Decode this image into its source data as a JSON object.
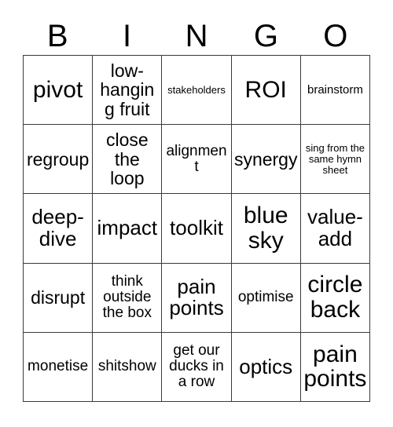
{
  "card": {
    "header": {
      "letters": [
        "B",
        "I",
        "N",
        "G",
        "O"
      ]
    },
    "grid": {
      "rows": [
        [
          {
            "text": "pivot",
            "size": "fs-xxl"
          },
          {
            "text": "low-hanging fruit",
            "size": "fs-lg"
          },
          {
            "text": "stakeholders",
            "size": "fs-xs"
          },
          {
            "text": "ROI",
            "size": "fs-xxl"
          },
          {
            "text": "brainstorm",
            "size": "fs-sm"
          }
        ],
        [
          {
            "text": "regroup",
            "size": "fs-lg"
          },
          {
            "text": "close the loop",
            "size": "fs-lg"
          },
          {
            "text": "alignment",
            "size": "fs-md"
          },
          {
            "text": "synergy",
            "size": "fs-lg"
          },
          {
            "text": "sing from the same hymn sheet",
            "size": "fs-xs"
          }
        ],
        [
          {
            "text": "deep-dive",
            "size": "fs-xl"
          },
          {
            "text": "impact",
            "size": "fs-xl"
          },
          {
            "text": "toolkit",
            "size": "fs-xl"
          },
          {
            "text": "blue sky",
            "size": "fs-xxl"
          },
          {
            "text": "value-add",
            "size": "fs-xl"
          }
        ],
        [
          {
            "text": "disrupt",
            "size": "fs-lg"
          },
          {
            "text": "think outside the box",
            "size": "fs-md"
          },
          {
            "text": "pain points",
            "size": "fs-xl"
          },
          {
            "text": "optimise",
            "size": "fs-md"
          },
          {
            "text": "circle back",
            "size": "fs-xxl"
          }
        ],
        [
          {
            "text": "monetise",
            "size": "fs-md"
          },
          {
            "text": "shitshow",
            "size": "fs-md"
          },
          {
            "text": "get our ducks in a row",
            "size": "fs-md"
          },
          {
            "text": "optics",
            "size": "fs-xl"
          },
          {
            "text": "pain points",
            "size": "fs-xxl"
          }
        ]
      ]
    },
    "colors": {
      "background": "#ffffff",
      "border": "#3a3a3a",
      "text": "#000000"
    }
  }
}
